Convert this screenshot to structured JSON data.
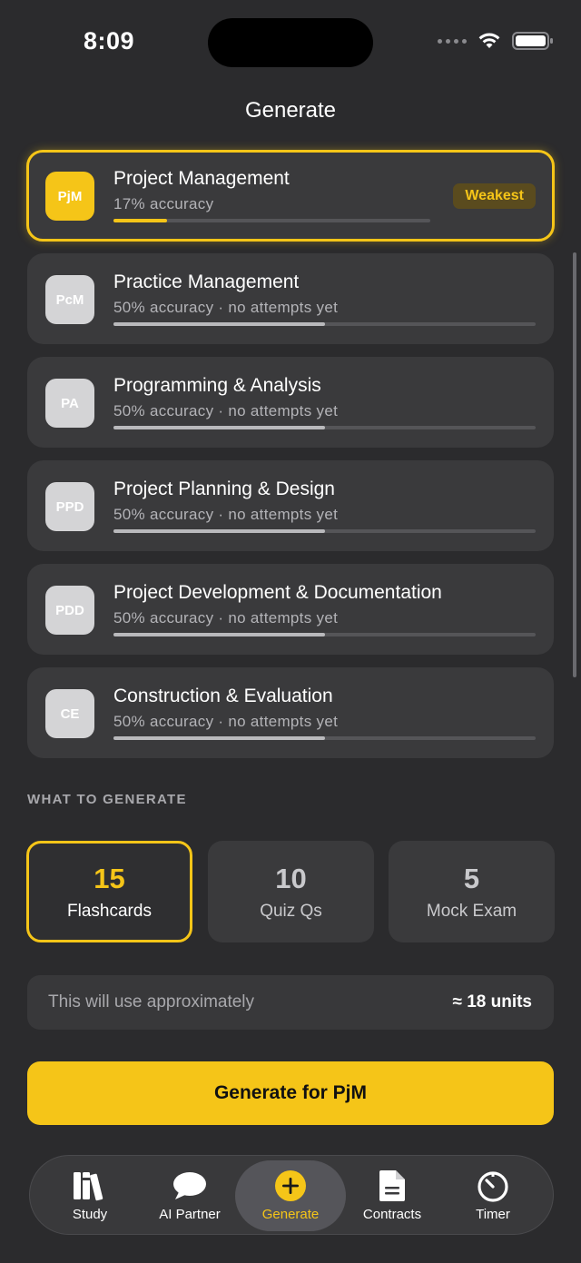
{
  "status_bar": {
    "time": "8:09"
  },
  "header": {
    "title": "Generate"
  },
  "divisions": [
    {
      "abbr": "PjM",
      "name": "Project Management",
      "subtitle": "17% accuracy",
      "progress": 0.17,
      "tag": "Weakest",
      "selected": true
    },
    {
      "abbr": "PcM",
      "name": "Practice Management",
      "subtitle": "50% accuracy · no attempts yet",
      "progress": 0.5,
      "selected": false
    },
    {
      "abbr": "PA",
      "name": "Programming & Analysis",
      "subtitle": "50% accuracy · no attempts yet",
      "progress": 0.5,
      "selected": false
    },
    {
      "abbr": "PPD",
      "name": "Project Planning & Design",
      "subtitle": "50% accuracy · no attempts yet",
      "progress": 0.5,
      "selected": false
    },
    {
      "abbr": "PDD",
      "name": "Project Development & Documentation",
      "subtitle": "50% accuracy · no attempts yet",
      "progress": 0.5,
      "selected": false
    },
    {
      "abbr": "CE",
      "name": "Construction & Evaluation",
      "subtitle": "50% accuracy · no attempts yet",
      "progress": 0.5,
      "selected": false
    }
  ],
  "what_to_generate": {
    "label": "WHAT TO GENERATE",
    "options": [
      {
        "count": "15",
        "label": "Flashcards",
        "selected": true
      },
      {
        "count": "10",
        "label": "Quiz Qs",
        "selected": false
      },
      {
        "count": "5",
        "label": "Mock Exam",
        "selected": false
      }
    ]
  },
  "usage": {
    "label": "This will use approximately",
    "value": "≈ 18 units"
  },
  "generate_button": {
    "label": "Generate for PjM"
  },
  "tabbar": {
    "tabs": [
      {
        "label": "Study",
        "icon": "books-icon"
      },
      {
        "label": "AI Partner",
        "icon": "chat-bubble-icon"
      },
      {
        "label": "Generate",
        "icon": "plus-circle-icon",
        "active": true
      },
      {
        "label": "Contracts",
        "icon": "document-icon"
      },
      {
        "label": "Timer",
        "icon": "timer-icon"
      }
    ]
  },
  "colors": {
    "accent": "#f5c518",
    "background": "#2b2b2d",
    "card": "#3a3a3c"
  }
}
